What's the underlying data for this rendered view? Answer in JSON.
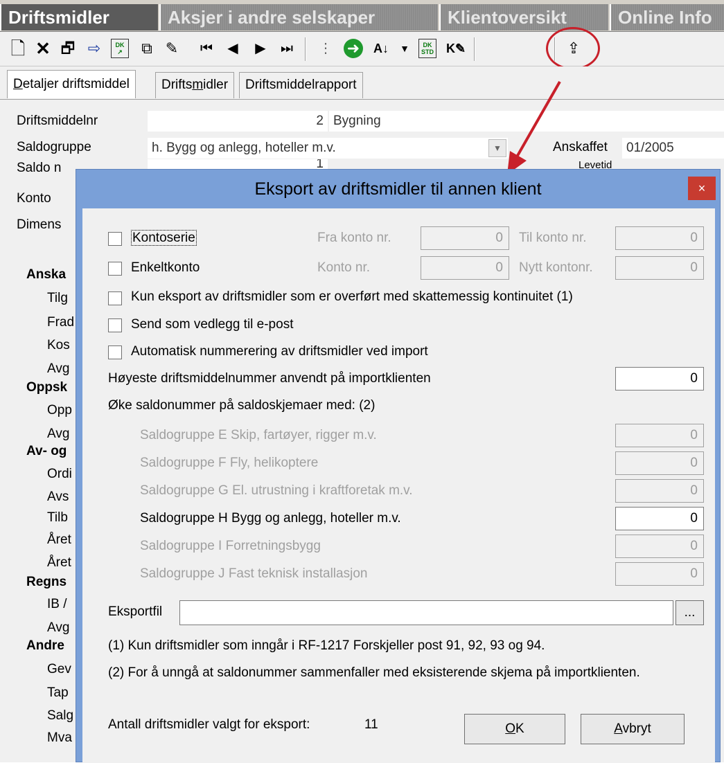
{
  "module_tabs": [
    "Driftsmidler",
    "Aksjer i andre selskaper",
    "Klientoversikt",
    "Online Info"
  ],
  "toolbar_icons": [
    "new-icon",
    "delete-icon",
    "properties-icon",
    "export-icon",
    "dk-import-icon",
    "copy-list-icon",
    "edit-icon",
    "first-record-icon",
    "previous-record-icon",
    "next-record-icon",
    "last-record-icon",
    "tree-icon",
    "go-icon",
    "sort-icon",
    "dropdown-icon",
    "dk-std-icon",
    "kv-edit-icon",
    "export-to-client-icon"
  ],
  "sub_tabs": {
    "detaljer": {
      "pre": "",
      "key": "D",
      "post": "etaljer driftsmiddel"
    },
    "driftsmidler": {
      "pre": "Drifts",
      "key": "m",
      "post": "idler"
    },
    "rapport": "Driftsmiddelrapport"
  },
  "background": {
    "driftsmiddelnr_label": "Driftsmiddelnr",
    "driftsmiddelnr_value": "2",
    "driftsmiddel_name": "Bygning",
    "saldogruppe_label": "Saldogruppe",
    "saldogruppe_value": "h. Bygg og anlegg, hoteller m.v.",
    "anskaffet_label": "Anskaffet",
    "anskaffet_value": "01/2005",
    "saldo_nr_label": "Saldo n",
    "saldo_nr_value": "1",
    "levetid_label": "Levetid",
    "konto_label": "Konto",
    "dimens_label": "Dimens",
    "left_labels": [
      {
        "text": "Anska",
        "bold": true
      },
      {
        "text": "Tilg",
        "bold": false
      },
      {
        "text": "Frad",
        "bold": false
      },
      {
        "text": "Kos",
        "bold": false
      },
      {
        "text": "Avg",
        "bold": false
      },
      {
        "text": "Oppsk",
        "bold": true
      },
      {
        "text": "Opp",
        "bold": false
      },
      {
        "text": "Avg",
        "bold": false
      },
      {
        "text": "Av- og",
        "bold": true
      },
      {
        "text": "Ordi",
        "bold": false
      },
      {
        "text": "Avs",
        "bold": false
      },
      {
        "text": "Tilb",
        "bold": false
      },
      {
        "text": "Året",
        "bold": false
      },
      {
        "text": "Året",
        "bold": false
      },
      {
        "text": "Regns",
        "bold": true
      },
      {
        "text": "IB /",
        "bold": false
      },
      {
        "text": "Avg",
        "bold": false
      },
      {
        "text": "Andre",
        "bold": true
      },
      {
        "text": "Gev",
        "bold": false
      },
      {
        "text": "Tap",
        "bold": false
      },
      {
        "text": "Salg",
        "bold": false
      },
      {
        "text": "Mva",
        "bold": false
      }
    ]
  },
  "dialog": {
    "title": "Eksport av driftsmidler til annen klient",
    "close_label": "×",
    "kontoserie_label": "Kontoserie",
    "fra_konto_label": "Fra konto nr.",
    "fra_konto_value": "0",
    "til_konto_label": "Til konto nr.",
    "til_konto_value": "0",
    "enkeltkonto_label": "Enkeltkonto",
    "konto_nr_label": "Konto nr.",
    "konto_nr_value": "0",
    "nytt_kontonr_label": "Nytt kontonr.",
    "nytt_kontonr_value": "0",
    "kun_eksport_label": "Kun eksport av driftsmidler som er overført med skattemessig kontinuitet (1)",
    "send_epost_label": "Send som vedlegg til e-post",
    "auto_nummerering_label": "Automatisk nummerering av driftsmidler ved import",
    "hoyeste_label": "Høyeste driftsmiddelnummer anvendt på importklienten",
    "hoyeste_value": "0",
    "oke_saldonummer_label": "Øke saldonummer på saldoskjemaer med: (2)",
    "saldogrupper": [
      {
        "label": "Saldogruppe E Skip, fartøyer, rigger m.v.",
        "value": "0",
        "enabled": false
      },
      {
        "label": "Saldogruppe F Fly, helikoptere",
        "value": "0",
        "enabled": false
      },
      {
        "label": "Saldogruppe G El. utrustning i kraftforetak m.v.",
        "value": "0",
        "enabled": false
      },
      {
        "label": "Saldogruppe H Bygg og anlegg, hoteller m.v.",
        "value": "0",
        "enabled": true
      },
      {
        "label": "Saldogruppe I Forretningsbygg",
        "value": "0",
        "enabled": false
      },
      {
        "label": "Saldogruppe J Fast teknisk installasjon",
        "value": "0",
        "enabled": false
      }
    ],
    "eksportfil_label": "Eksportfil",
    "eksportfil_value": "",
    "browse_label": "...",
    "note1": "(1) Kun driftsmidler som inngår i RF-1217 Forskjeller post 91, 92, 93 og 94.",
    "note2": "(2) For å unngå at saldonummer sammenfaller med eksisterende skjema på importklienten.",
    "antall_label": "Antall driftsmidler valgt for eksport:",
    "antall_value": "11",
    "ok": {
      "key": "O",
      "rest": "K"
    },
    "avbryt": {
      "key": "A",
      "rest": "vbryt"
    }
  },
  "colors": {
    "dialog_frame": "#7aa0d8",
    "close_button": "#c73b30",
    "highlight": "#c8202a",
    "active_module_tab": "#5b5b5b"
  }
}
